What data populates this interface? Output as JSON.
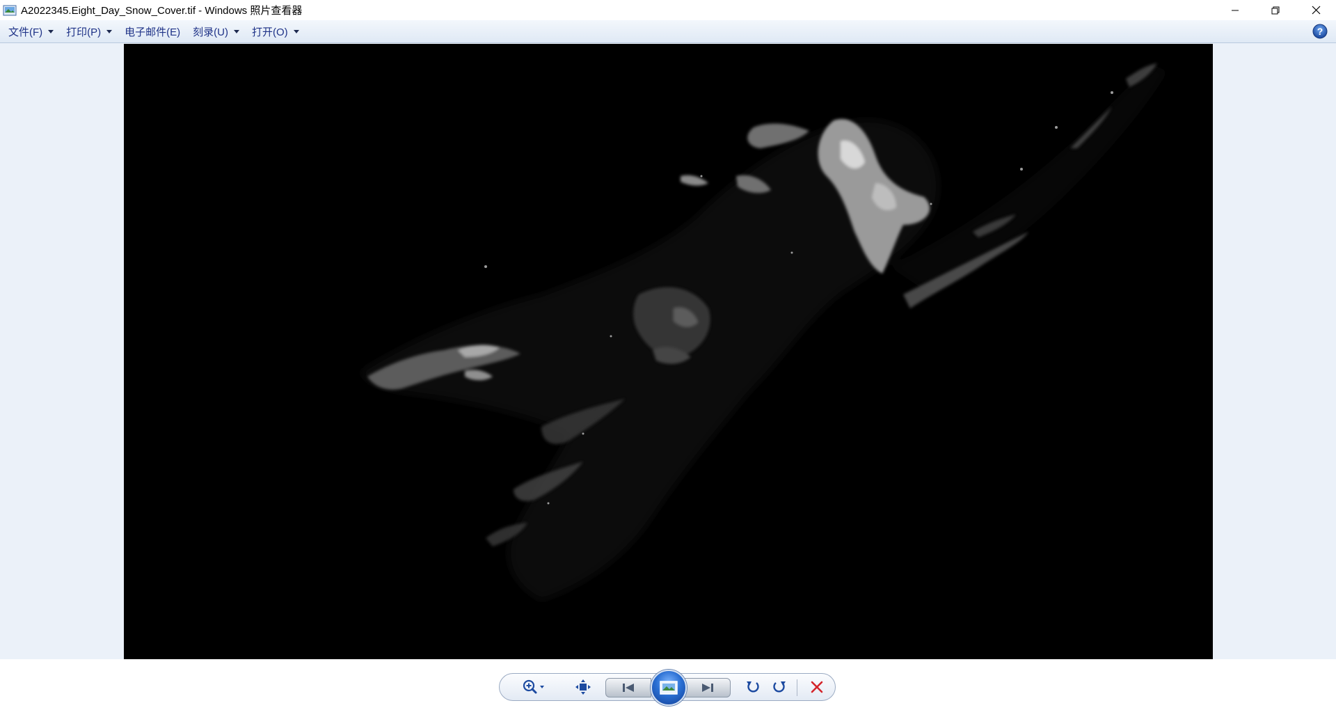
{
  "window": {
    "title": "A2022345.Eight_Day_Snow_Cover.tif - Windows 照片查看器"
  },
  "menu": {
    "items": [
      {
        "label": "文件(F)",
        "has_dropdown": true
      },
      {
        "label": "打印(P)",
        "has_dropdown": true
      },
      {
        "label": "电子邮件(E)",
        "has_dropdown": false
      },
      {
        "label": "刻录(U)",
        "has_dropdown": true
      },
      {
        "label": "打开(O)",
        "has_dropdown": true
      }
    ]
  },
  "icons": {
    "app": "photo-viewer-icon",
    "minimize": "minimize-icon",
    "restore": "restore-icon",
    "close": "close-icon",
    "help": "help-icon",
    "zoom": "zoom-icon",
    "actual_size": "actual-size-icon",
    "previous": "previous-icon",
    "slideshow": "slideshow-icon",
    "next": "next-icon",
    "rotate_ccw": "rotate-counterclockwise-icon",
    "rotate_cw": "rotate-clockwise-icon",
    "delete": "delete-icon"
  },
  "colors": {
    "menu_text": "#1e3287",
    "viewer_bg": "#ebf1f9",
    "delete_red": "#d4242a",
    "accent_blue": "#2a6fd3"
  }
}
